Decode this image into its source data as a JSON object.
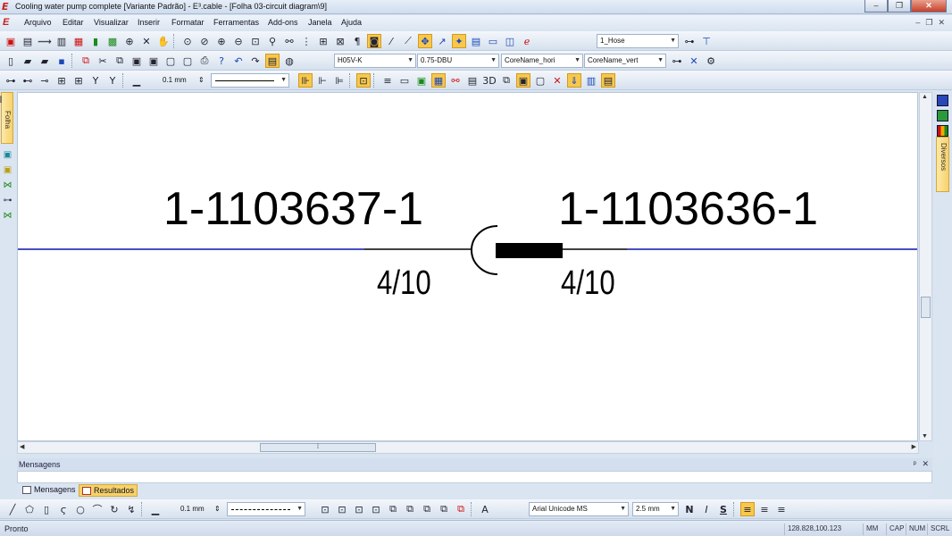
{
  "window": {
    "title": "Cooling water pump complete [Variante Padrão] - E³.cable - [Folha 03-circuit diagram\\9]",
    "app_icon_glyph": "E",
    "minimize": "–",
    "restore": "❐",
    "close": "✕"
  },
  "menu": {
    "items": [
      "Arquivo",
      "Editar",
      "Visualizar",
      "Inserir",
      "Formatar",
      "Ferramentas",
      "Add-ons",
      "Janela",
      "Ajuda"
    ],
    "mdi_minimize": "–",
    "mdi_restore": "❐",
    "mdi_close": "✕"
  },
  "toolbar1": {
    "combo_value": "1_Hose"
  },
  "toolbar2": {
    "cable_type": "H05V-K",
    "wire_size": "0.75-DBU",
    "core_name_h": "CoreName_hori",
    "core_name_v": "CoreName_vert"
  },
  "toolbar3": {
    "line_width": "0.1 mm",
    "view_3d": "3D"
  },
  "side": {
    "left_tab": "Folha",
    "right_tab": "Diversos"
  },
  "diagram": {
    "left_part": "1-1103637-1",
    "right_part": "1-1103636-1",
    "left_pin": "4/10",
    "right_pin": "4/10",
    "wire_color": "#0a14a8"
  },
  "messages": {
    "header": "Mensagens",
    "pin": "ᵖ",
    "close": "✕",
    "tabs": [
      "Mensagens",
      "Resultados"
    ]
  },
  "toolbar_bottom": {
    "line_width": "0.1 mm",
    "font": "Arial Unicode MS",
    "font_size": "2.5 mm",
    "bold": "N",
    "italic": "I",
    "underline": "S",
    "text_tool": "A"
  },
  "status": {
    "text": "Pronto",
    "coords": "128.828,100.123",
    "mm": "MM",
    "cap": "CAP",
    "num": "NUM",
    "scrl": "SCRL"
  }
}
